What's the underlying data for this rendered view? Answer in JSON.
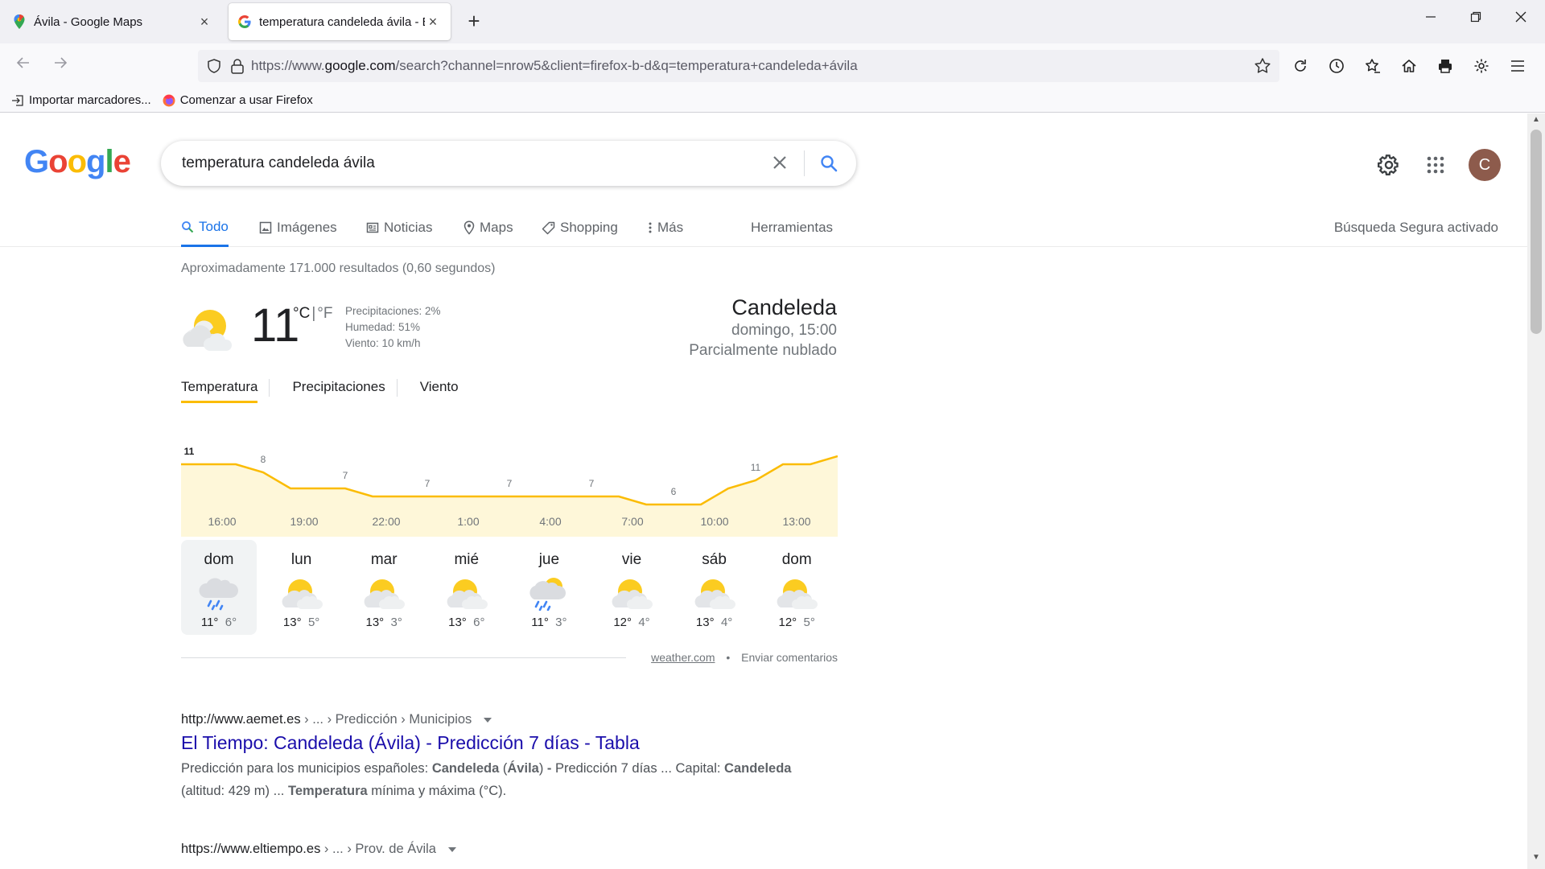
{
  "browser": {
    "tabs": [
      {
        "title": "Ávila - Google Maps",
        "active": false
      },
      {
        "title": "temperatura candeleda ávila - B",
        "active": true
      }
    ],
    "url": {
      "prefix": "https://www.",
      "domain": "google.com",
      "rest": "/search?channel=nrow5&client=firefox-b-d&q=temperatura+candeleda+ávila"
    },
    "bookmarks": [
      {
        "label": "Importar marcadores...",
        "icon": "import-icon"
      },
      {
        "label": "Comenzar a usar Firefox",
        "icon": "firefox-icon"
      }
    ]
  },
  "google": {
    "logo": {
      "g1": "G",
      "o1": "o",
      "o2": "o",
      "g2": "g",
      "l": "l",
      "e": "e"
    },
    "query": "temperatura candeleda ávila",
    "avatar_letter": "C",
    "tabs": [
      {
        "label": "Todo",
        "icon": "search-icon",
        "active": true
      },
      {
        "label": "Imágenes",
        "icon": "image-icon"
      },
      {
        "label": "Noticias",
        "icon": "news-icon"
      },
      {
        "label": "Maps",
        "icon": "pin-icon"
      },
      {
        "label": "Shopping",
        "icon": "tag-icon"
      },
      {
        "label": "Más",
        "icon": "more-vert-icon"
      },
      {
        "label": "Herramientas"
      }
    ],
    "safe_search": "Búsqueda Segura activado",
    "stats": "Aproximadamente 171.000 resultados (0,60 segundos)"
  },
  "weather": {
    "temp": "11",
    "unit_c": "°C",
    "unit_sep": "|",
    "unit_f": "°F",
    "precip": "Precipitaciones: 2%",
    "humidity": "Humedad: 51%",
    "wind": "Viento: 10 km/h",
    "city": "Candeleda",
    "datetime": "domingo, 15:00",
    "condition": "Parcialmente nublado",
    "tabs": [
      "Temperatura",
      "Precipitaciones",
      "Viento"
    ],
    "accent": "#fbbc04",
    "footer_source": "weather.com",
    "footer_dot": "•",
    "footer_feedback": "Enviar comentarios",
    "days": [
      {
        "name": "dom",
        "hi": "11°",
        "lo": "6°",
        "icon": "rain-cloud-icon",
        "active": true
      },
      {
        "name": "lun",
        "hi": "13°",
        "lo": "5°",
        "icon": "partly-cloudy-icon"
      },
      {
        "name": "mar",
        "hi": "13°",
        "lo": "3°",
        "icon": "partly-cloudy-icon"
      },
      {
        "name": "mié",
        "hi": "13°",
        "lo": "6°",
        "icon": "partly-cloudy-icon"
      },
      {
        "name": "jue",
        "hi": "11°",
        "lo": "3°",
        "icon": "showers-icon"
      },
      {
        "name": "vie",
        "hi": "12°",
        "lo": "4°",
        "icon": "partly-cloudy-icon"
      },
      {
        "name": "sáb",
        "hi": "13°",
        "lo": "4°",
        "icon": "partly-cloudy-icon"
      },
      {
        "name": "dom",
        "hi": "12°",
        "lo": "5°",
        "icon": "partly-cloudy-icon"
      }
    ]
  },
  "chart_data": {
    "type": "area",
    "x": [
      "15:00",
      "16:00",
      "17:00",
      "18:00",
      "19:00",
      "20:00",
      "21:00",
      "22:00",
      "23:00",
      "0:00",
      "1:00",
      "2:00",
      "3:00",
      "4:00",
      "5:00",
      "6:00",
      "7:00",
      "8:00",
      "9:00",
      "10:00",
      "11:00",
      "12:00",
      "13:00",
      "14:00",
      "15:00"
    ],
    "values": [
      11,
      11,
      11,
      10,
      8,
      8,
      8,
      7,
      7,
      7,
      7,
      7,
      7,
      7,
      7,
      7,
      7,
      6,
      6,
      6,
      8,
      9,
      11,
      11,
      12
    ],
    "point_labels": [
      {
        "index": 0,
        "text": "11"
      },
      {
        "index": 3,
        "text": "8"
      },
      {
        "index": 6,
        "text": "7"
      },
      {
        "index": 9,
        "text": "7"
      },
      {
        "index": 12,
        "text": "7"
      },
      {
        "index": 15,
        "text": "7"
      },
      {
        "index": 18,
        "text": "6"
      },
      {
        "index": 21,
        "text": "11"
      }
    ],
    "tick_labels": [
      {
        "index": 1,
        "text": "16:00"
      },
      {
        "index": 4,
        "text": "19:00"
      },
      {
        "index": 7,
        "text": "22:00"
      },
      {
        "index": 10,
        "text": "1:00"
      },
      {
        "index": 13,
        "text": "4:00"
      },
      {
        "index": 16,
        "text": "7:00"
      },
      {
        "index": 19,
        "text": "10:00"
      },
      {
        "index": 22,
        "text": "13:00"
      }
    ],
    "ylim": [
      0,
      14
    ],
    "line_color": "#fbbc04",
    "fill_color": "#fef7d9"
  },
  "results": [
    {
      "cite": "http://www.aemet.es",
      "crumbs": " › ... › Predicción › Municipios",
      "title": "El Tiempo: Candeleda (Ávila) - Predicción 7 días - Tabla",
      "snippet_parts": [
        {
          "t": "Predicción para los municipios españoles: ",
          "b": false
        },
        {
          "t": "Candeleda",
          "b": true
        },
        {
          "t": " (",
          "b": false
        },
        {
          "t": "Ávila",
          "b": true
        },
        {
          "t": ") ",
          "b": false
        },
        {
          "t": "-",
          "b": true
        },
        {
          "t": " Predicción 7 días ... Capital: ",
          "b": false
        },
        {
          "t": "Candeleda",
          "b": true
        },
        {
          "t": " (altitud: 429 m) ... ",
          "b": false
        },
        {
          "t": "Temperatura",
          "b": true
        },
        {
          "t": " mínima y máxima (°C).",
          "b": false
        }
      ]
    },
    {
      "cite": "https://www.eltiempo.es",
      "crumbs": " › ... › Prov. de Ávila"
    }
  ]
}
